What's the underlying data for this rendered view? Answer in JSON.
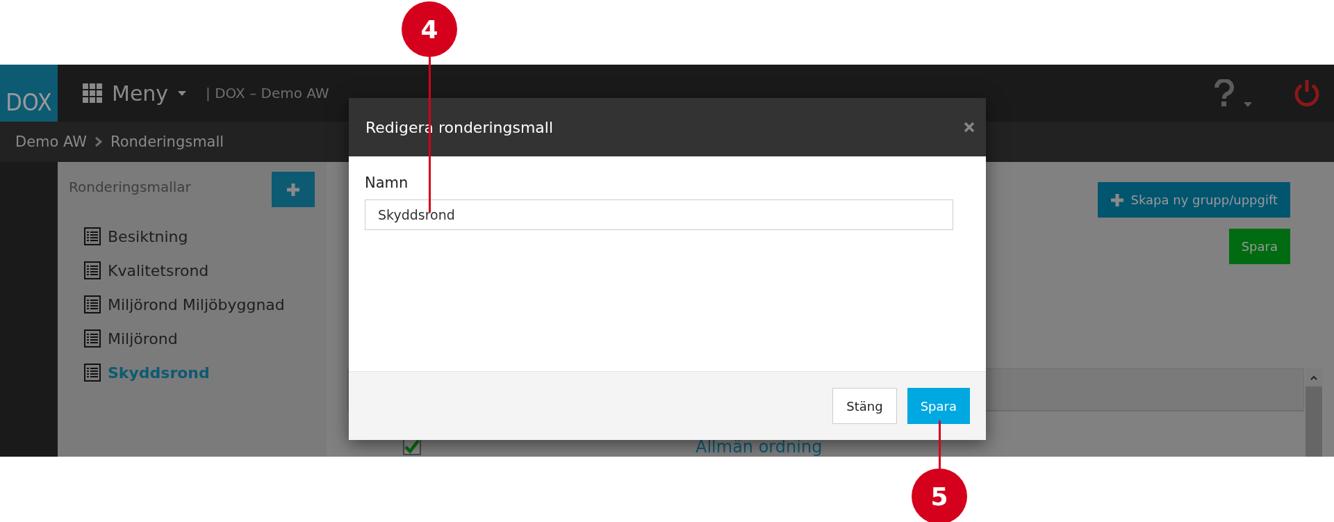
{
  "header": {
    "logo": "DOX",
    "menu_label": "Meny",
    "context": "| DOX – Demo AW"
  },
  "breadcrumb": [
    {
      "label": "Demo AW"
    },
    {
      "label": "Ronderingsmall"
    }
  ],
  "sidebar": {
    "title": "Ronderingsmallar",
    "items": [
      {
        "label": "Besiktning",
        "selected": false
      },
      {
        "label": "Kvalitetsrond",
        "selected": false
      },
      {
        "label": "Miljörond Miljöbyggnad",
        "selected": false
      },
      {
        "label": "Miljörond",
        "selected": false
      },
      {
        "label": "Skyddsrond",
        "selected": true
      }
    ]
  },
  "main": {
    "buttons": [
      {
        "label": "Skapa ny grupp/uppgift",
        "kind": "primary"
      },
      {
        "label": "Spara",
        "kind": "success"
      }
    ],
    "rows": [
      {
        "label": "Allmän ordning",
        "checked": true
      }
    ]
  },
  "dialog": {
    "title": "Redigera ronderingsmall",
    "field": {
      "label": "Namn",
      "value": "Skyddsrond"
    },
    "buttons": [
      {
        "label": "Stäng",
        "kind": "default"
      },
      {
        "label": "Spara",
        "kind": "primary"
      }
    ]
  },
  "callouts": [
    {
      "number": "4"
    },
    {
      "number": "5"
    }
  ]
}
